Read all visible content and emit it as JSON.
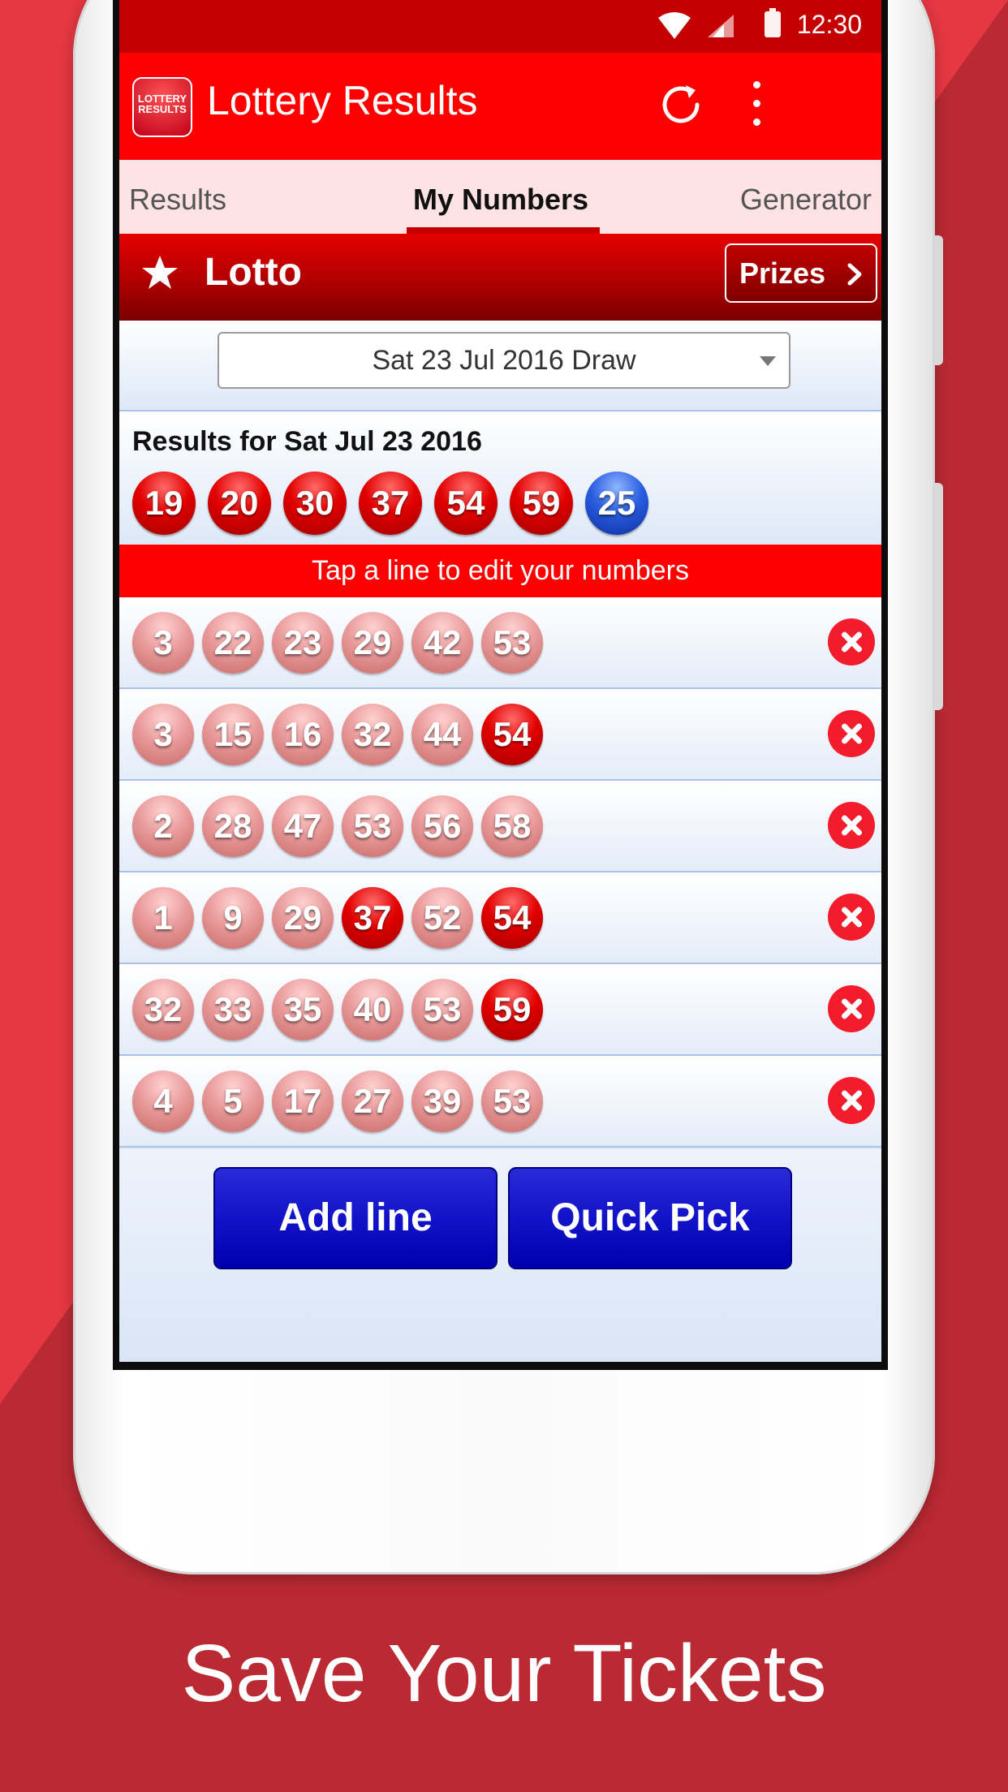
{
  "status_bar": {
    "time": "12:30"
  },
  "app_bar": {
    "logo_text": "LOTTERY RESULTS",
    "title": "Lottery Results"
  },
  "tabs": [
    {
      "label": "Results",
      "selected": false
    },
    {
      "label": "My Numbers",
      "selected": true
    },
    {
      "label": "Generator",
      "selected": false
    }
  ],
  "game": {
    "title": "Lotto",
    "prizes_label": "Prizes"
  },
  "draw_select": {
    "value": "Sat 23 Jul 2016 Draw"
  },
  "results": {
    "title": "Results for Sat Jul 23 2016",
    "main_numbers": [
      "19",
      "20",
      "30",
      "37",
      "54",
      "59"
    ],
    "bonus_number": "25"
  },
  "instruction": "Tap a line to edit your numbers",
  "lines": [
    {
      "numbers": [
        "3",
        "22",
        "23",
        "29",
        "42",
        "53"
      ],
      "matched": [
        false,
        false,
        false,
        false,
        false,
        false
      ]
    },
    {
      "numbers": [
        "3",
        "15",
        "16",
        "32",
        "44",
        "54"
      ],
      "matched": [
        false,
        false,
        false,
        false,
        false,
        true
      ]
    },
    {
      "numbers": [
        "2",
        "28",
        "47",
        "53",
        "56",
        "58"
      ],
      "matched": [
        false,
        false,
        false,
        false,
        false,
        false
      ]
    },
    {
      "numbers": [
        "1",
        "9",
        "29",
        "37",
        "52",
        "54"
      ],
      "matched": [
        false,
        false,
        false,
        true,
        false,
        true
      ]
    },
    {
      "numbers": [
        "32",
        "33",
        "35",
        "40",
        "53",
        "59"
      ],
      "matched": [
        false,
        false,
        false,
        false,
        false,
        true
      ]
    },
    {
      "numbers": [
        "4",
        "5",
        "17",
        "27",
        "39",
        "53"
      ],
      "matched": [
        false,
        false,
        false,
        false,
        false,
        false
      ]
    }
  ],
  "buttons": {
    "add_line": "Add line",
    "quick_pick": "Quick Pick"
  },
  "caption": "Save Your Tickets",
  "colors": {
    "background": "#e73a45",
    "app_bar": "#ff0000",
    "status_bar": "#c40000",
    "tab_strip": "#fde3e3",
    "action_button": "#1212c8",
    "delete": "#f21c2c"
  }
}
